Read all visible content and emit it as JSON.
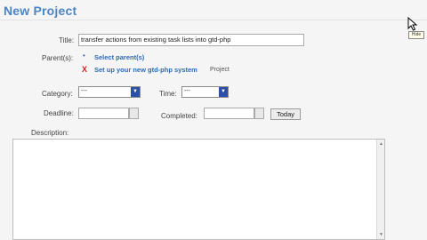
{
  "page": {
    "title": "New Project"
  },
  "form": {
    "title_label": "Title:",
    "title_value": "transfer actions from existing task lists into gtd-php",
    "parents_label": "Parent(s):",
    "select_parents_link": "Select parent(s)",
    "parent_item": {
      "name": "Set up your new gtd-php system",
      "type": "Project"
    },
    "category_label": "Category:",
    "category_value": "---",
    "time_label": "Time:",
    "time_value": "---",
    "deadline_label": "Deadline:",
    "deadline_value": "",
    "completed_label": "Completed:",
    "completed_value": "",
    "today_button": "Today",
    "description_label": "Description:",
    "description_value": ""
  },
  "tooltip": {
    "text": "Hide"
  },
  "icons": {
    "bullet": "bullet-icon",
    "remove": "remove-x-icon",
    "dropdown": "chevron-down-icon",
    "calendar": "calendar-icon",
    "cursor": "mouse-pointer-icon"
  },
  "colors": {
    "title": "#4a86c4",
    "link": "#2d6ab5",
    "remove": "#cc2222",
    "select_arrow": "#2b4fa8"
  }
}
